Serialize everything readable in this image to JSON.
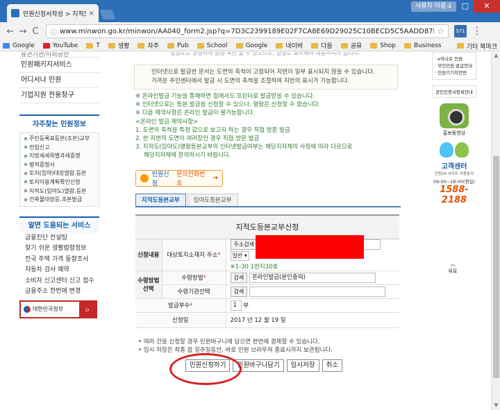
{
  "browser": {
    "tab_title": "민원신청서작성 > 지적도",
    "tab_close": "×",
    "user_badge": "사용자 이름 1",
    "win_min": "–",
    "win_max": "□",
    "win_close": "✕",
    "nav_back": "←",
    "nav_forward": "→",
    "nav_reload": "C",
    "url": "www.minwon.go.kr/minwon/AA040_form2.jsp?q=7D3C2399189E02F7CA8E69D29025C10BECD5C5AADD87D4&charset=EUC-KR",
    "star": "☆",
    "ext_label": "S71",
    "menu": "⋮",
    "bookmarks": [
      {
        "label": "Google",
        "icon": "google"
      },
      {
        "label": "YouTube",
        "icon": "youtube"
      },
      {
        "label": "T",
        "icon": "folder"
      },
      {
        "label": "생활",
        "icon": "folder"
      },
      {
        "label": "자주",
        "icon": "folder"
      },
      {
        "label": "Pub",
        "icon": "folder"
      },
      {
        "label": "School",
        "icon": "folder"
      },
      {
        "label": "Google",
        "icon": "folder"
      },
      {
        "label": "네이버",
        "icon": "folder"
      },
      {
        "label": "다음",
        "icon": "folder"
      },
      {
        "label": "공유",
        "icon": "folder"
      },
      {
        "label": "Shop",
        "icon": "folder"
      },
      {
        "label": "Business",
        "icon": "folder"
      }
    ],
    "bookmarks_other": "기타 북마크"
  },
  "leftnav": {
    "cut_top": "유관기관/사회공헌",
    "links": [
      "민원패키지서비스",
      "어디서나 민원",
      "기업지원 전용창구"
    ],
    "faq_head": "자주찾는 민원정보",
    "faq_items": [
      "주민등록표등본(초본)교부",
      "전입신고",
      "지방세세목별과세증명",
      "병적증명서",
      "토지(임야)대장열람.등본",
      "토지이용계획확인신청",
      "지적도(임야도)열람.등본",
      "건축물대장등.초본발급"
    ],
    "svc_head": "알면 도움되는 서비스",
    "svc_items": [
      "금융진단 컨설팅",
      "찾기 쉬운 생활법령정보",
      "전국 주택 가격 동향조사",
      "자동차 검사 예약",
      "소비자 신고센터 신고 접수",
      "금융주소 한번에 변경"
    ],
    "gov_text": "대한민국정부",
    "gov_search_icon": "⌕"
  },
  "rightnav": {
    "box1": [
      "e하나로 민원",
      "무인민원 발급안내",
      "민원기기치안면"
    ],
    "box2": "공인인증서등록안내",
    "promo": "홍보동영상",
    "call_title": "고객센터",
    "call_sub": "민원24 사이트 이용문의",
    "call_hours": "09:00~18:00(평일)",
    "call_number": "1588-2188",
    "top_btn": "위로"
  },
  "main": {
    "cut_line": "일정도로 경영하게 발급 옥진 볼 수 있으므로, 열실로 표시해서 대응하시기 됩니다.",
    "notice": [
      "인터넷으로 발급한 문서는 도면의 축척이 고정되어 지번이 일부 표시되지 않을 수 있습니다.",
      "가까운 주민센터에서 발급 시 도면의 축척을 조절하여 지번의 표시가 가능합니다."
    ],
    "green_notes": [
      "※ 온라인발급 기능을 통해하면 접에서도 프린터로 발급받을 수 있습니다.",
      "※ 인터넷으로는 등본 발급을 신청할 수 있으나, 열람은 신청할 수 없습니다.",
      "※ 다음 제약사항은 온라인 발급이 불가능합니다.",
      "<온라인 발급 제약사항>",
      "1. 도면의 축척을 특정 값으로 보고자 하는 경우 직접 방문 발급",
      "2. 한 지번의 도면이 여러장인 경우 직접 방문 발급",
      "3. 지적도(임야도)열람등본교부의 인터넷발급여부는 해당지자체의 사정에 따라 다르므로",
      "    해당지자체에 문의하시기 바랍니다."
    ],
    "inquiry_label1": "민원신청",
    "inquiry_label2": "문의전화번호",
    "inquiry_arrow": "➜",
    "tabs": [
      "지적도등본교부",
      "임야도등본교부"
    ],
    "form_title": "지적도등본교부신청",
    "row1_group": "신청내용",
    "row1_label": "대상토지소재지 주소",
    "addr_search": "주소검색",
    "select_value": "일반 ▾",
    "row1_hint": "※1-30 1번지30호",
    "row2_group": "수령방법 선택",
    "row2_label": "수령방법",
    "row2_search": "검색",
    "row2_value": "온라인발급(본인출력)",
    "row3_label": "수령기관선택",
    "row3_search": "검색",
    "row4_label": "발급부수",
    "row4_value": "1",
    "row4_unit": "부",
    "row5_label": "신청일",
    "row5_value": "2017 년 12 월 19 일",
    "req_mark": "*",
    "bottom_notes": [
      "• 여러 건을 신청할 경우 민원바구니에 담으면 한번에 결제할 수 있습니다.",
      "• 임시 저장은 최종 접 일주일동안, 바로 민원 브라우져 종료시까지 보관됩니다."
    ],
    "buttons": [
      "민원신청하기",
      "민원바구니담기",
      "임시저장",
      "취소"
    ]
  },
  "colors": {
    "annotation_circle": "#d42020",
    "redaction": "#ff0000"
  }
}
